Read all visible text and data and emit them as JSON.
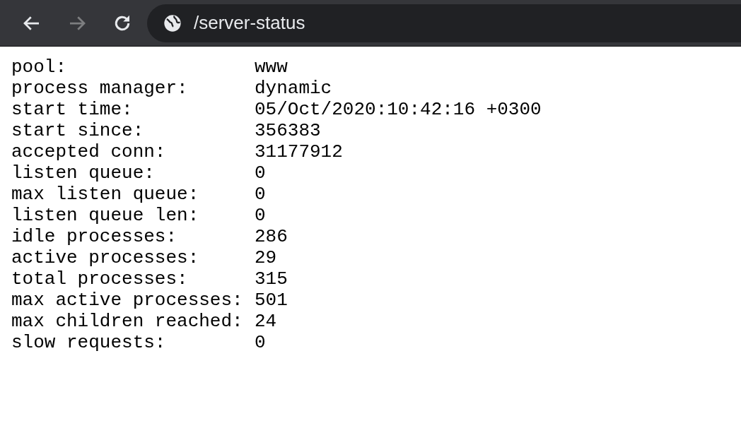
{
  "toolbar": {
    "back": {
      "disabled": false
    },
    "forward": {
      "disabled": true
    },
    "address": "/server-status"
  },
  "status": [
    {
      "label": "pool:",
      "value": "www"
    },
    {
      "label": "process manager:",
      "value": "dynamic"
    },
    {
      "label": "start time:",
      "value": "05/Oct/2020:10:42:16 +0300"
    },
    {
      "label": "start since:",
      "value": "356383"
    },
    {
      "label": "accepted conn:",
      "value": "31177912"
    },
    {
      "label": "listen queue:",
      "value": "0"
    },
    {
      "label": "max listen queue:",
      "value": "0"
    },
    {
      "label": "listen queue len:",
      "value": "0"
    },
    {
      "label": "idle processes:",
      "value": "286"
    },
    {
      "label": "active processes:",
      "value": "29"
    },
    {
      "label": "total processes:",
      "value": "315"
    },
    {
      "label": "max active processes:",
      "value": "501"
    },
    {
      "label": "max children reached:",
      "value": "24"
    },
    {
      "label": "slow requests:",
      "value": "0"
    }
  ]
}
